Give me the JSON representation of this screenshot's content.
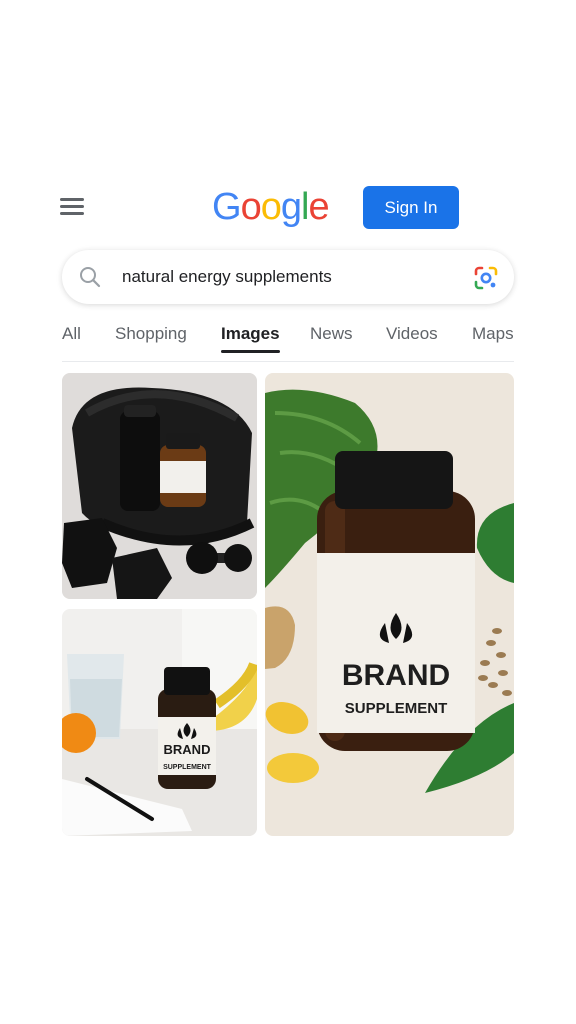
{
  "header": {
    "logo_letters": [
      {
        "ch": "G",
        "color": "#4285F4"
      },
      {
        "ch": "o",
        "color": "#EA4335"
      },
      {
        "ch": "o",
        "color": "#FBBC05"
      },
      {
        "ch": "g",
        "color": "#4285F4"
      },
      {
        "ch": "l",
        "color": "#34A853"
      },
      {
        "ch": "e",
        "color": "#EA4335"
      }
    ],
    "signin_label": "Sign In"
  },
  "search": {
    "query": "natural energy supplements"
  },
  "tabs": [
    {
      "label": "All",
      "active": false
    },
    {
      "label": "Shopping",
      "active": false
    },
    {
      "label": "Images",
      "active": true
    },
    {
      "label": "News",
      "active": false
    },
    {
      "label": "Videos",
      "active": false
    },
    {
      "label": "Maps",
      "active": false
    }
  ],
  "results": {
    "tile_2_label": {
      "brand": "BRAND",
      "sub": "SUPPLEMENT"
    },
    "tile_3_label": {
      "brand": "BRAND",
      "sub": "SUPPLEMENT"
    }
  },
  "colors": {
    "accent": "#1a73e8",
    "tab_text": "#5f6368",
    "active_tab": "#202124"
  }
}
